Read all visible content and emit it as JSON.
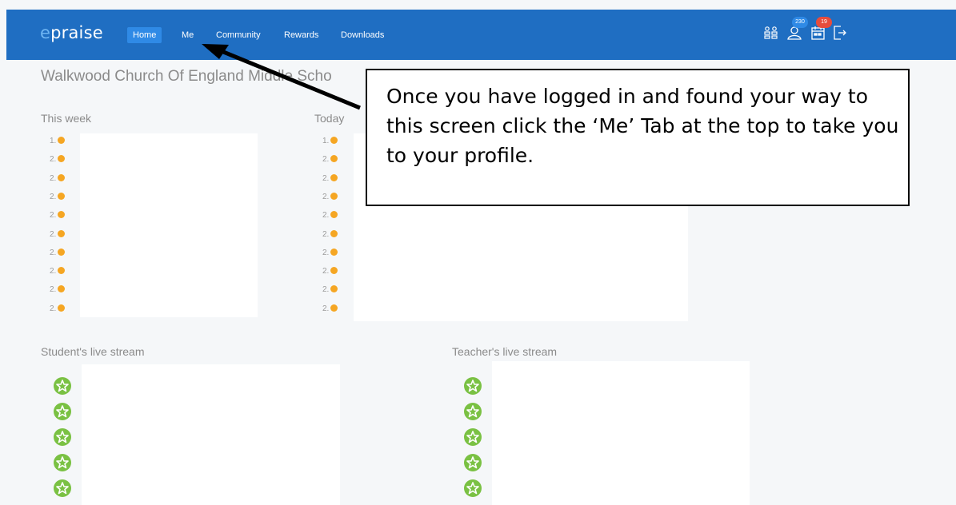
{
  "app": {
    "logo_e": "e",
    "logo_rest": "praise"
  },
  "nav": {
    "items": [
      "Home",
      "Me",
      "Community",
      "Rewards",
      "Downloads"
    ]
  },
  "header_icons": {
    "notifications_count": "230",
    "messages_count": "19"
  },
  "school": {
    "name": "Walkwood Church Of England Middle Scho"
  },
  "leaderboards": {
    "this_week": {
      "title": "This week",
      "ranks": [
        "1.",
        "2.",
        "2.",
        "2.",
        "2.",
        "2.",
        "2.",
        "2.",
        "2.",
        "2."
      ]
    },
    "today": {
      "title": "Today",
      "ranks": [
        "1.",
        "2.",
        "2.",
        "2.",
        "2.",
        "2.",
        "2.",
        "2.",
        "2.",
        "2."
      ]
    }
  },
  "streams": {
    "students": {
      "title": "Student's live stream"
    },
    "teachers": {
      "title": "Teacher's live stream"
    }
  },
  "callout": {
    "text": "Once you have logged in and found your way to this screen click the ‘Me’ Tab at the top to take you to your profile."
  },
  "colors": {
    "navbar": "#1f6ec2",
    "active_tab": "#2f8ae6",
    "rank_dot": "#f5a623",
    "star": "#7ac143",
    "badge_blue": "#2f8ae6",
    "badge_red": "#e74c3c"
  }
}
